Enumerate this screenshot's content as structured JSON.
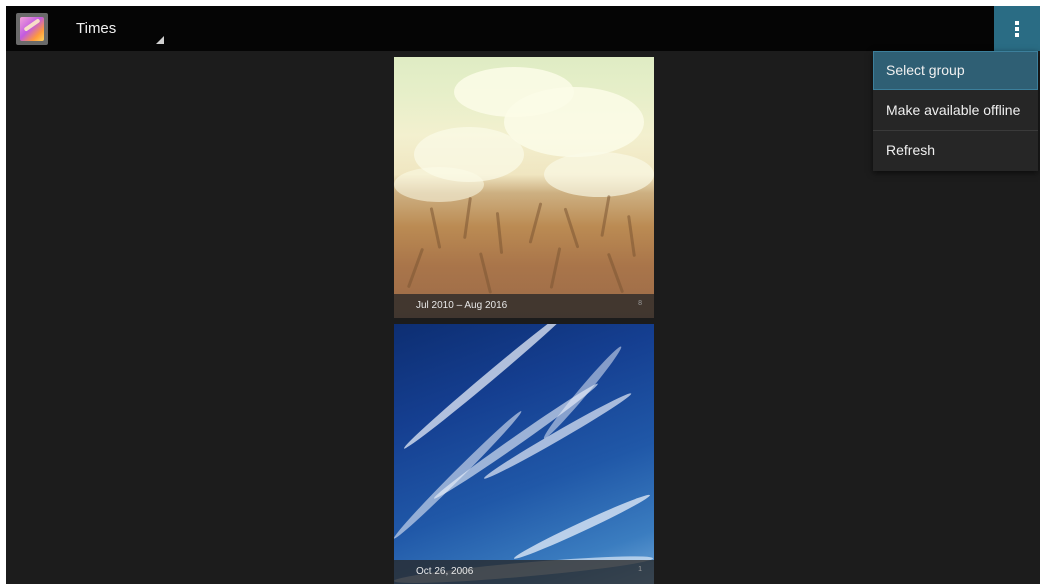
{
  "action_bar": {
    "title": "Times",
    "app_icon": "gallery-icon",
    "overflow_icon": "overflow-menu-icon",
    "accent_color": "#2a6c84"
  },
  "albums": [
    {
      "date_range": "Jul 2010 – Aug 2016",
      "count": "8",
      "image": "wheat-field-photo"
    },
    {
      "date_range": "Oct 26, 2006",
      "count": "1",
      "image": "blue-sky-clouds-photo"
    }
  ],
  "overflow_menu": {
    "items": [
      {
        "label": "Select group",
        "selected": true
      },
      {
        "label": "Make available offline",
        "selected": false
      },
      {
        "label": "Refresh",
        "selected": false
      }
    ]
  }
}
